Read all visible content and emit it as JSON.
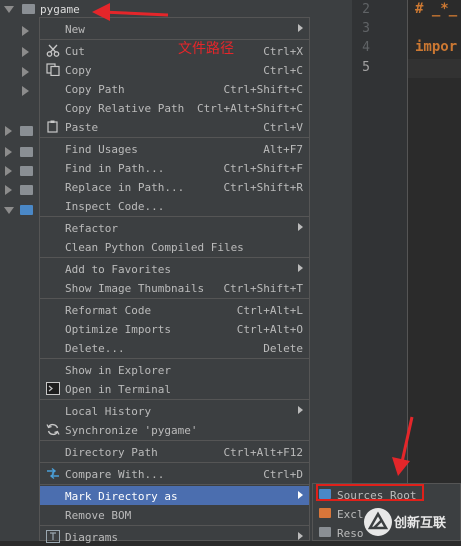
{
  "project_tree": {
    "root_label": "pygame"
  },
  "annotation": {
    "text": "文件路径"
  },
  "editor": {
    "line_numbers": [
      "2",
      "3",
      "4",
      "5"
    ],
    "code_lines": [
      "# _*_",
      "",
      "impor",
      ""
    ]
  },
  "context_menu": {
    "items": [
      {
        "label": "New",
        "shortcut": "",
        "submenu": true
      },
      {
        "label": "Cut",
        "shortcut": "Ctrl+X",
        "icon": "scissors-icon"
      },
      {
        "label": "Copy",
        "shortcut": "Ctrl+C",
        "icon": "copy-icon"
      },
      {
        "label": "Copy Path",
        "shortcut": "Ctrl+Shift+C"
      },
      {
        "label": "Copy Relative Path",
        "shortcut": "Ctrl+Alt+Shift+C"
      },
      {
        "label": "Paste",
        "shortcut": "Ctrl+V",
        "icon": "paste-icon"
      },
      {
        "label": "Find Usages",
        "shortcut": "Alt+F7"
      },
      {
        "label": "Find in Path...",
        "shortcut": "Ctrl+Shift+F"
      },
      {
        "label": "Replace in Path...",
        "shortcut": "Ctrl+Shift+R"
      },
      {
        "label": "Inspect Code...",
        "shortcut": ""
      },
      {
        "label": "Refactor",
        "shortcut": "",
        "submenu": true
      },
      {
        "label": "Clean Python Compiled Files",
        "shortcut": ""
      },
      {
        "label": "Add to Favorites",
        "shortcut": "",
        "submenu": true
      },
      {
        "label": "Show Image Thumbnails",
        "shortcut": "Ctrl+Shift+T"
      },
      {
        "label": "Reformat Code",
        "shortcut": "Ctrl+Alt+L"
      },
      {
        "label": "Optimize Imports",
        "shortcut": "Ctrl+Alt+O"
      },
      {
        "label": "Delete...",
        "shortcut": "Delete"
      },
      {
        "label": "Show in Explorer",
        "shortcut": ""
      },
      {
        "label": "Open in Terminal",
        "shortcut": "",
        "icon": "terminal-icon"
      },
      {
        "label": "Local History",
        "shortcut": "",
        "submenu": true
      },
      {
        "label": "Synchronize 'pygame'",
        "shortcut": "",
        "icon": "sync-icon"
      },
      {
        "label": "Directory Path",
        "shortcut": "Ctrl+Alt+F12"
      },
      {
        "label": "Compare With...",
        "shortcut": "Ctrl+D",
        "icon": "compare-icon"
      },
      {
        "label": "Mark Directory as",
        "shortcut": "",
        "submenu": true,
        "highlighted": true
      },
      {
        "label": "Remove BOM",
        "shortcut": ""
      },
      {
        "label": "Diagrams",
        "shortcut": "",
        "submenu": true,
        "icon": "diagram-icon"
      }
    ]
  },
  "submenu": {
    "items": [
      {
        "label": "Sources Root",
        "icon_color": "#4a88c7"
      },
      {
        "label": "Excl",
        "icon_color": "#d9763a"
      },
      {
        "label": "Reso",
        "icon_color": "#8a8f94"
      }
    ]
  },
  "watermark": {
    "text": "创新互联"
  },
  "colors": {
    "accent": "#4b6eaf",
    "annotation_red": "#e4262a"
  }
}
